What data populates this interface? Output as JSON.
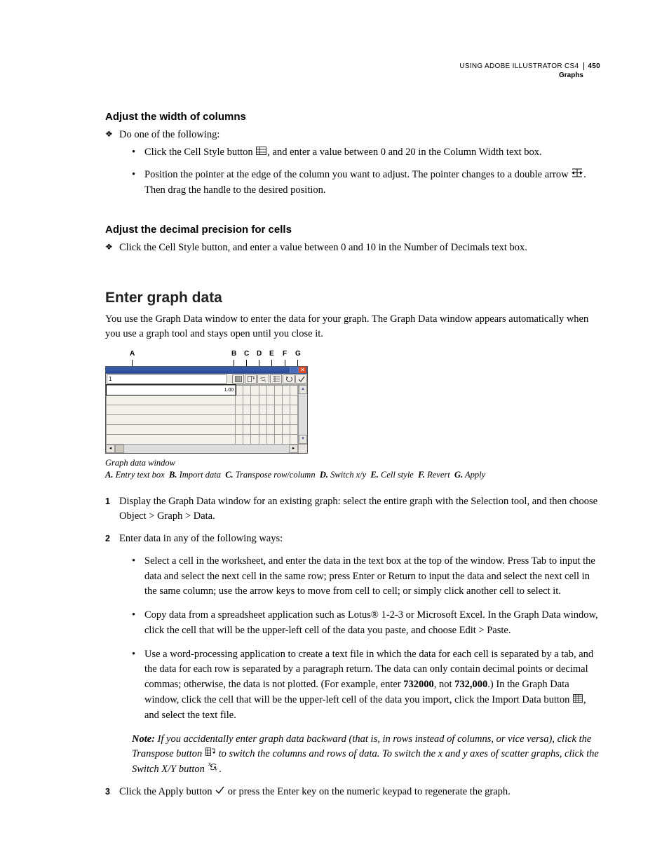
{
  "header": {
    "product": "USING ADOBE ILLUSTRATOR CS4",
    "page_number": "450",
    "chapter": "Graphs"
  },
  "sec1": {
    "heading": "Adjust the width of columns",
    "intro": "Do one of the following:",
    "b1a": "Click the Cell Style button ",
    "b1b": ", and enter a value between 0 and 20 in the Column Width text box.",
    "b2a": "Position the pointer at the edge of the column you want to adjust. The pointer changes to a double arrow ",
    "b2b": ". Then drag the handle to the desired position."
  },
  "sec2": {
    "heading": "Adjust the decimal precision for cells",
    "b1": "Click the Cell Style button, and enter a value between 0 and 10 in the Number of Decimals text box."
  },
  "sec3": {
    "heading": "Enter graph data",
    "intro": "You use the Graph Data window to enter the data for your graph. The Graph Data window appears automatically when you use a graph tool and stays open until you close it."
  },
  "figure": {
    "labels": {
      "A": "A",
      "B": "B",
      "C": "C",
      "D": "D",
      "E": "E",
      "F": "F",
      "G": "G"
    },
    "entry_value": "1",
    "cell_value": "1.00",
    "caption": "Graph data window",
    "legend": {
      "A": "Entry text box",
      "B": "Import data",
      "C": "Transpose row/column",
      "D": "Switch x/y",
      "E": "Cell style",
      "F": "Revert",
      "G": "Apply"
    }
  },
  "steps": {
    "s1": "Display the Graph Data window for an existing graph: select the entire graph with the Selection tool, and then choose Object > Graph > Data.",
    "s2": "Enter data in any of the following ways:",
    "s2a": "Select a cell in the worksheet, and enter the data in the text box at the top of the window. Press Tab to input the data and select the next cell in the same row; press Enter or Return to input the data and select the next cell in the same column; use the arrow keys to move from cell to cell; or simply click another cell to select it.",
    "s2b": "Copy data from a spreadsheet application such as Lotus® 1‑2‑3 or Microsoft Excel. In the Graph Data window, click the cell that will be the upper-left cell of the data you paste, and choose Edit > Paste.",
    "s2c_1": "Use a word-processing application to create a text file in which the data for each cell is separated by a tab, and the data for each row is separated by a paragraph return. The data can only contain decimal points or decimal commas; otherwise, the data is not plotted. (For example, enter ",
    "s2c_ex1": "732000",
    "s2c_2": ", not ",
    "s2c_ex2": "732,000",
    "s2c_3": ".) In the Graph Data window, click the cell that will be the upper-left cell of the data you import, click the Import Data button ",
    "s2c_4": ", and select the text file.",
    "note_label": "Note:",
    "note_1": " If you accidentally enter graph data backward (that is, in rows instead of columns, or vice versa), click the Transpose button ",
    "note_2": " to switch the columns and rows of data. To switch the x and y axes of scatter graphs, click the Switch X/Y button ",
    "note_3": ".",
    "s3_1": "Click the Apply button ",
    "s3_2": " or press the Enter key on the numeric keypad to regenerate the graph."
  }
}
